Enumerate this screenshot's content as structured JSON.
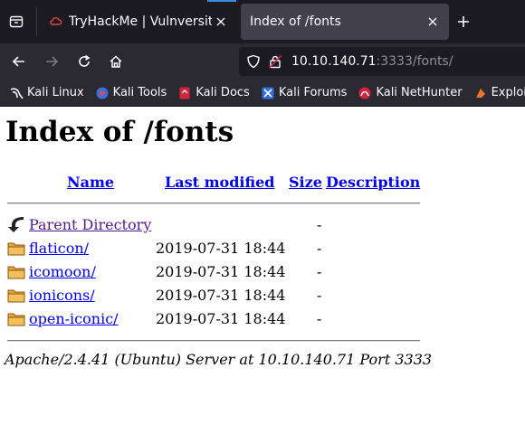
{
  "browser": {
    "tabs": [
      {
        "title": "TryHackMe | Vulnversity",
        "favicon": "tryhackme-icon",
        "active": false
      },
      {
        "title": "Index of /fonts",
        "favicon": "none",
        "active": true
      }
    ],
    "url": {
      "host": "10.10.140.71",
      "rest": ":3333/fonts/"
    },
    "bookmarks": [
      {
        "label": "Kali Linux",
        "icon": "kali-dragon-icon"
      },
      {
        "label": "Kali Tools",
        "icon": "kali-tools-icon"
      },
      {
        "label": "Kali Docs",
        "icon": "kali-docs-icon"
      },
      {
        "label": "Kali Forums",
        "icon": "kali-forums-icon"
      },
      {
        "label": "Kali NetHunter",
        "icon": "kali-nethunter-icon"
      },
      {
        "label": "Exploit-DB",
        "icon": "exploit-db-icon"
      }
    ]
  },
  "page": {
    "title": "Index of /fonts",
    "columns": {
      "name": "Name",
      "modified": "Last modified",
      "size": "Size",
      "description": "Description"
    },
    "rows": [
      {
        "name": "Parent Directory",
        "modified": "",
        "size": "-",
        "icon": "back-arrow-icon"
      },
      {
        "name": "flaticon/",
        "modified": "2019-07-31 18:44",
        "size": "-",
        "icon": "folder-icon"
      },
      {
        "name": "icomoon/",
        "modified": "2019-07-31 18:44",
        "size": "-",
        "icon": "folder-icon"
      },
      {
        "name": "ionicons/",
        "modified": "2019-07-31 18:44",
        "size": "-",
        "icon": "folder-icon"
      },
      {
        "name": "open-iconic/",
        "modified": "2019-07-31 18:44",
        "size": "-",
        "icon": "folder-icon"
      }
    ],
    "address": "Apache/2.4.41 (Ubuntu) Server at 10.10.140.71 Port 3333"
  },
  "colors": {
    "chrome_dark": "#1c1b22",
    "toolbar": "#2b2a33",
    "link": "#0000ee",
    "visited": "#551a8b",
    "folder": "#e8a33c"
  }
}
